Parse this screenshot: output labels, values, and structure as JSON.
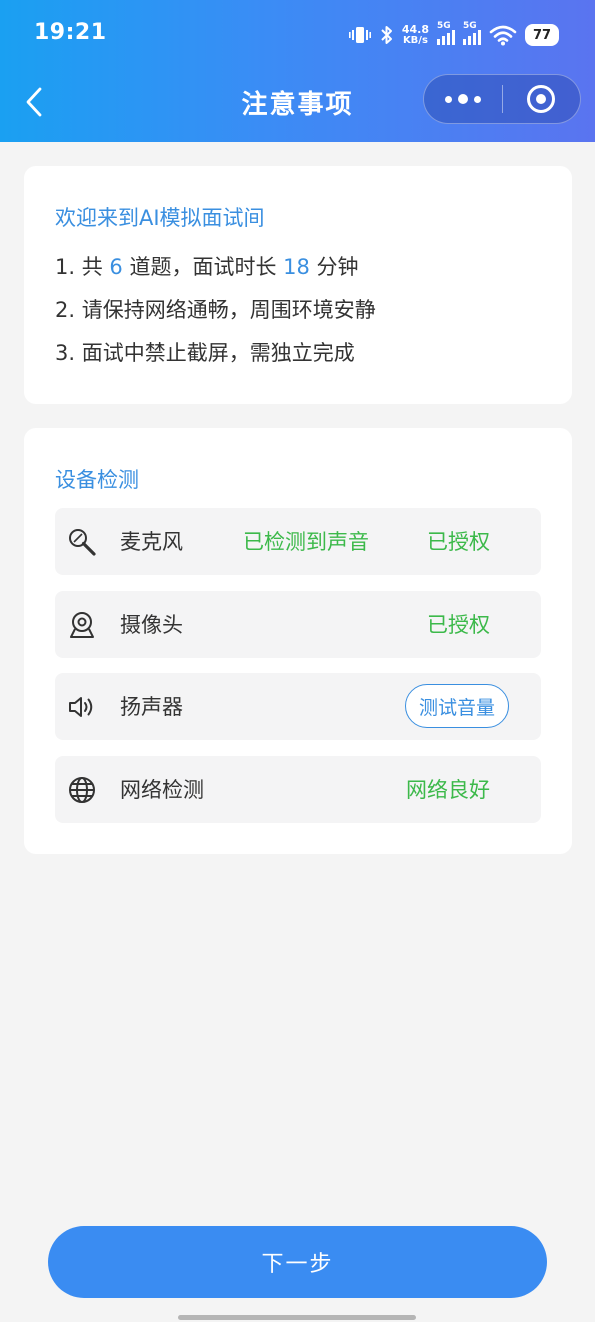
{
  "status_bar": {
    "time": "19:21",
    "net_speed_value": "44.8",
    "net_speed_unit": "KB/s",
    "sim1_label": "5G",
    "sim2_label": "5G",
    "battery": "77"
  },
  "navbar": {
    "title": "注意事项"
  },
  "notice": {
    "title": "欢迎来到AI模拟面试间",
    "rule1_prefix": "1. 共 ",
    "question_count": "6",
    "rule1_middle": " 道题，面试时长 ",
    "duration": "18",
    "rule1_suffix": " 分钟",
    "rule2": "2. 请保持网络通畅，周围环境安静",
    "rule3": "3. 面试中禁止截屏，需独立完成"
  },
  "devices": {
    "title": "设备检测",
    "items": [
      {
        "icon": "microphone-icon",
        "name": "麦克风",
        "detail": "已检测到声音",
        "status": "已授权"
      },
      {
        "icon": "camera-icon",
        "name": "摄像头",
        "status": "已授权"
      },
      {
        "icon": "speaker-icon",
        "name": "扬声器",
        "action": "测试音量"
      },
      {
        "icon": "globe-icon",
        "name": "网络检测",
        "status": "网络良好"
      }
    ]
  },
  "footer": {
    "next_label": "下一步"
  },
  "colors": {
    "accent": "#3a8fe0",
    "success": "#3cb94a",
    "button": "#3a8cf2",
    "header_gradient_start": "#1aa0f2",
    "header_gradient_end": "#5a74f0"
  }
}
